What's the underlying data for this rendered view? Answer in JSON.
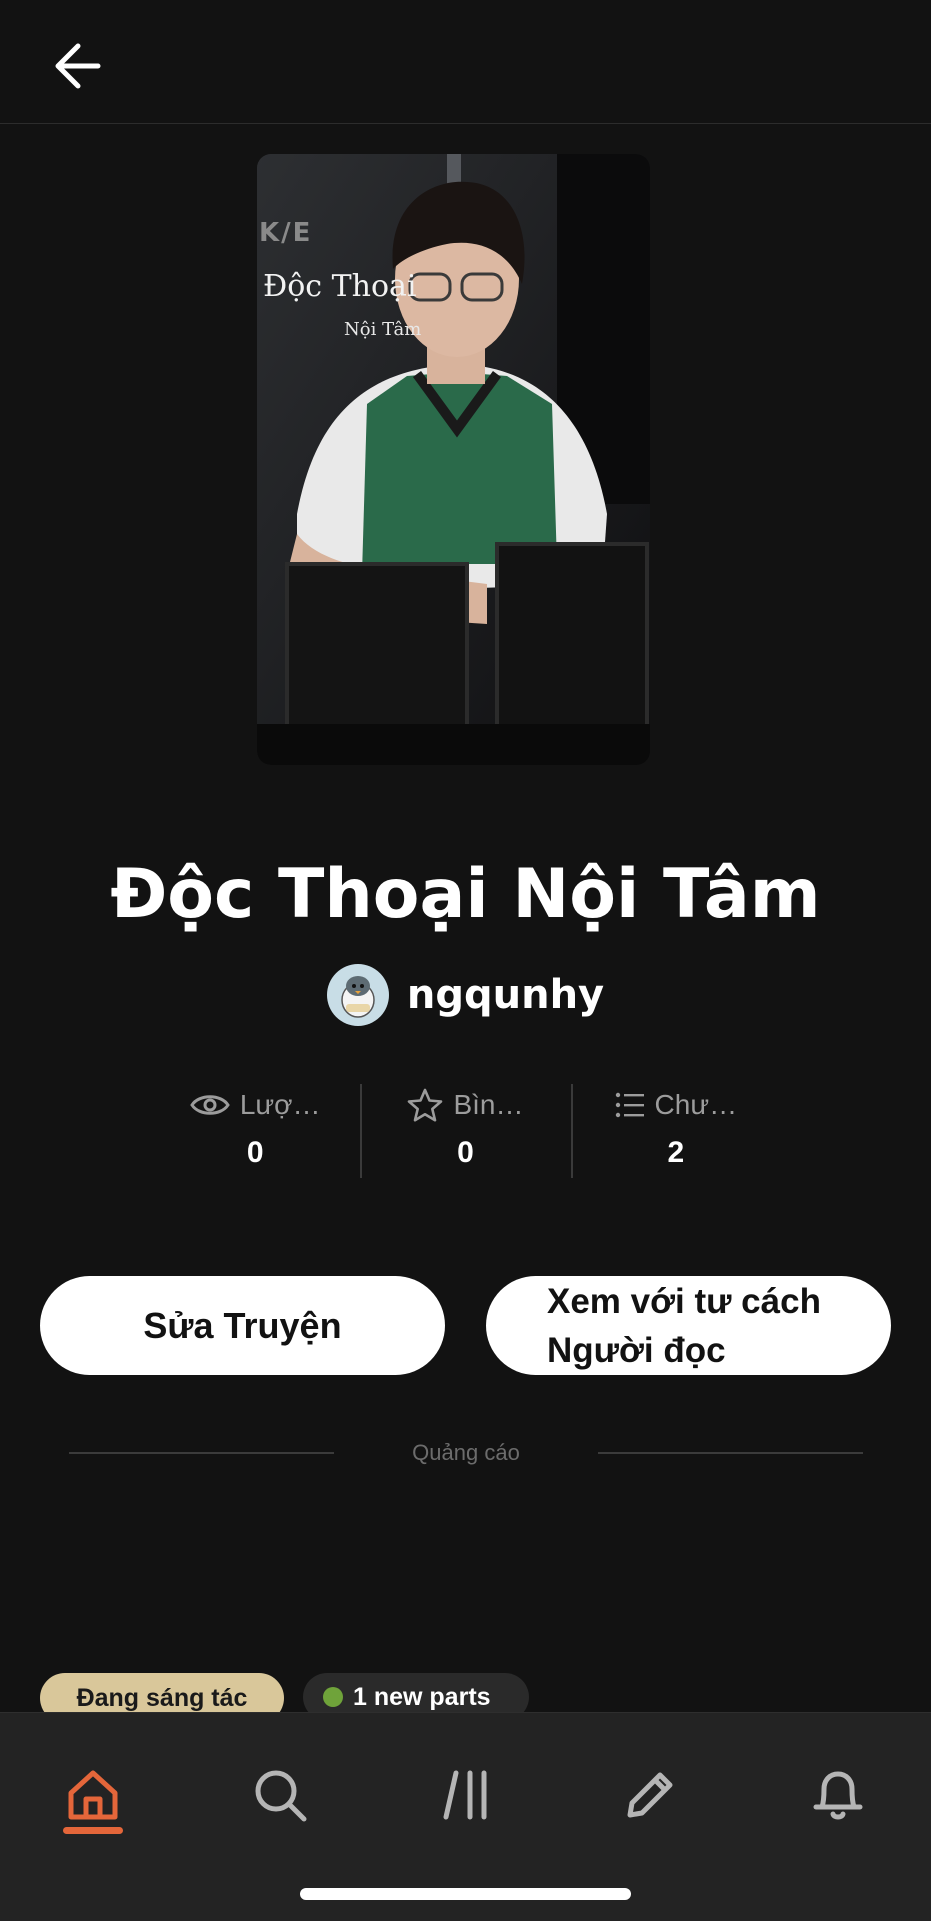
{
  "header": {
    "back_icon": "arrow-left-icon"
  },
  "cover": {
    "title_line1": "Độc Thoại",
    "title_line2": "Nội Tâm",
    "corner_mark": "K/E"
  },
  "story": {
    "title": "Độc Thoại Nội Tâm",
    "author": "ngqunhy"
  },
  "stats": [
    {
      "icon": "eye-icon",
      "label": "Lượ…",
      "value": "0"
    },
    {
      "icon": "star-icon",
      "label": "Bìn…",
      "value": "0"
    },
    {
      "icon": "list-icon",
      "label": "Chư…",
      "value": "2"
    }
  ],
  "actions": {
    "edit_label": "Sửa Truyện",
    "view_as_reader_label": "Xem với tư cách Người đọc"
  },
  "ad": {
    "label": "Quảng cáo"
  },
  "badges": {
    "status": "Đang sáng tác",
    "new_parts": "1 new parts"
  },
  "bottom_nav": {
    "items": [
      "home-icon",
      "search-icon",
      "library-icon",
      "write-icon",
      "bell-icon"
    ],
    "active": "home-icon"
  },
  "colors": {
    "background": "#121212",
    "accent": "#e4663a",
    "status_badge": "#d9c79a",
    "new_dot": "#6fa33a"
  }
}
